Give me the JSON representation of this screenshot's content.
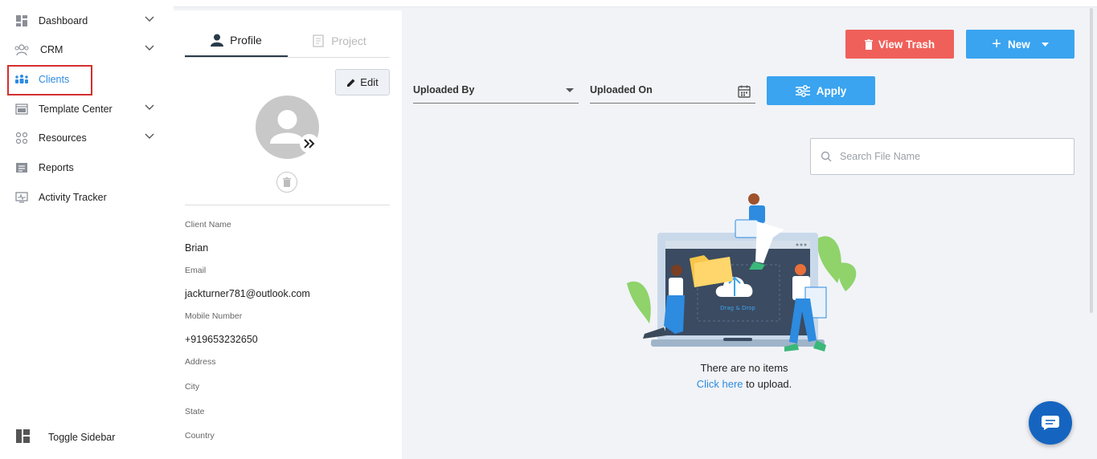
{
  "sidebar": {
    "items": [
      {
        "label": "Dashboard",
        "icon": "dashboard-icon",
        "has_chevron": true
      },
      {
        "label": "CRM",
        "icon": "crm-icon",
        "has_chevron": true
      },
      {
        "label": "Clients",
        "icon": "clients-icon",
        "has_chevron": false,
        "active": true
      },
      {
        "label": "Template Center",
        "icon": "template-icon",
        "has_chevron": true
      },
      {
        "label": "Resources",
        "icon": "resources-icon",
        "has_chevron": true
      },
      {
        "label": "Reports",
        "icon": "reports-icon",
        "has_chevron": false
      },
      {
        "label": "Activity Tracker",
        "icon": "activity-icon",
        "has_chevron": false
      }
    ],
    "toggle_label": "Toggle Sidebar"
  },
  "panel": {
    "tabs": [
      {
        "label": "Profile",
        "active": true
      },
      {
        "label": "Project",
        "active": false
      }
    ],
    "edit_label": "Edit",
    "fields": [
      {
        "label": "Client Name",
        "value": "Brian"
      },
      {
        "label": "Email",
        "value": "jackturner781@outlook.com"
      },
      {
        "label": "Mobile Number",
        "value": "+919653232650"
      },
      {
        "label": "Address",
        "value": ""
      },
      {
        "label": "City",
        "value": ""
      },
      {
        "label": "State",
        "value": ""
      },
      {
        "label": "Country",
        "value": ""
      }
    ]
  },
  "toolbar": {
    "view_trash_label": "View Trash",
    "new_label": "New"
  },
  "filters": {
    "uploaded_by": "Uploaded By",
    "uploaded_on": "Uploaded On",
    "apply_label": "Apply"
  },
  "search": {
    "placeholder": "Search File Name"
  },
  "empty_state": {
    "illustration_caption": "Drag & Drop",
    "message": "There are no items",
    "link_text": "Click here",
    "suffix": "to upload."
  },
  "colors": {
    "accent": "#3aa4f0",
    "danger": "#f0605a",
    "active_nav": "#2d8be0",
    "highlight_border": "#d32f2f",
    "chat": "#1565c0"
  }
}
